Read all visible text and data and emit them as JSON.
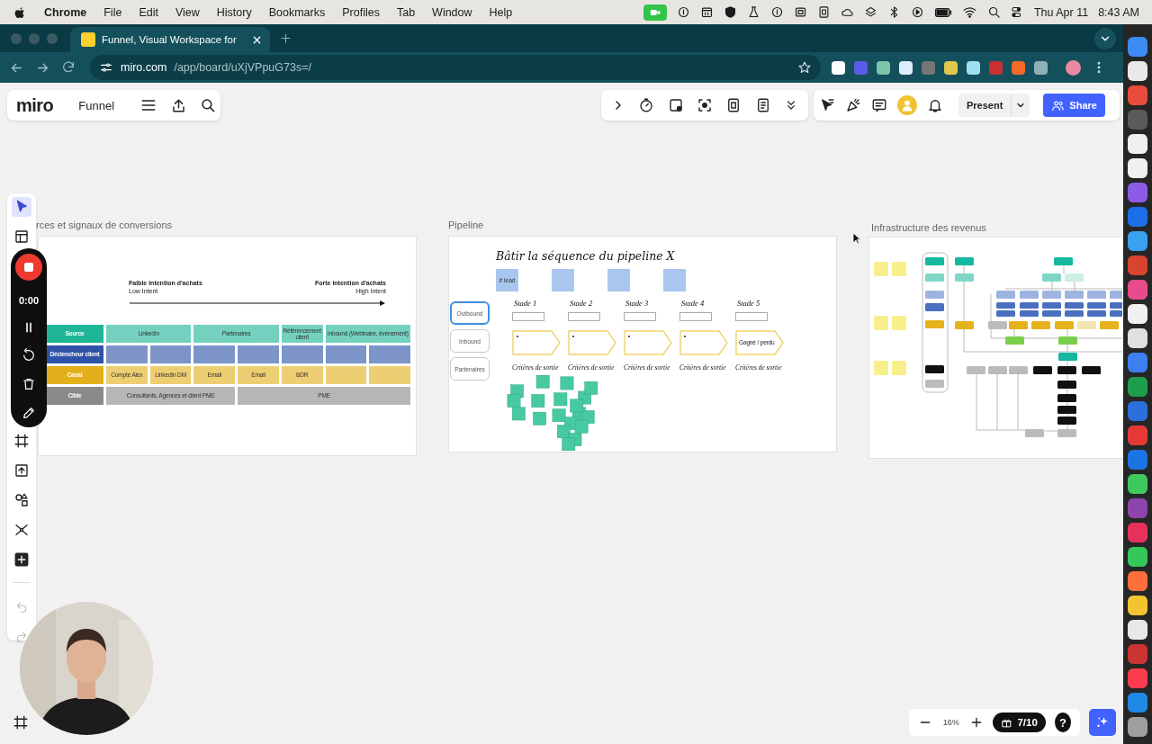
{
  "menubar": {
    "app_name": "Chrome",
    "menus": [
      "File",
      "Edit",
      "View",
      "History",
      "Bookmarks",
      "Profiles",
      "Tab",
      "Window",
      "Help"
    ],
    "date": "Thu Apr 11",
    "time": "8:43 AM"
  },
  "browser": {
    "tab": {
      "title": "Funnel, Visual Workspace for",
      "selected": true
    },
    "url": {
      "host": "miro.com",
      "path": "/app/board/uXjVPpuG73s=/"
    }
  },
  "board_header": {
    "logo": "miro",
    "board_name": "Funnel"
  },
  "top_toolbar": {
    "present": "Present",
    "share": "Share"
  },
  "left_toolbar": {
    "tools": [
      {
        "kind": "select",
        "selected": true
      },
      {
        "kind": "templates",
        "selected": false
      },
      {
        "kind": "frame",
        "selected": false
      },
      {
        "kind": "upload",
        "selected": false
      },
      {
        "kind": "shapes",
        "selected": false
      },
      {
        "kind": "mindmap",
        "selected": false
      },
      {
        "kind": "more",
        "selected": false
      }
    ],
    "history": [
      {
        "kind": "undo",
        "disabled": true
      },
      {
        "kind": "redo",
        "disabled": true
      }
    ]
  },
  "recorder": {
    "time": "0:00"
  },
  "frames": [
    {
      "kind": "matrix",
      "title": "rces et signaux de conversions",
      "low_intent": {
        "label": "Faible intention d'achats",
        "sublabel": "Low Intent"
      },
      "high_intent": {
        "label": "Forte intention d'achats",
        "sublabel": "High Intent"
      },
      "rows": [
        {
          "header": "Source",
          "color": "#1fb597",
          "blocks": [
            {
              "kind": "label",
              "text": "LinkedIn"
            },
            {
              "kind": "label",
              "text": "Partenaires"
            },
            {
              "kind": "label",
              "text": "Référencement client"
            },
            {
              "kind": "label",
              "text": "Inbound (Webinaire, événement)"
            }
          ]
        },
        {
          "header": "Déclencheur client",
          "color": "#2e52a8",
          "blocks": [
            {
              "kind": "blank"
            },
            {
              "kind": "blank"
            },
            {
              "kind": "blank"
            },
            {
              "kind": "blank"
            },
            {
              "kind": "blank"
            },
            {
              "kind": "blank"
            },
            {
              "kind": "blank"
            }
          ]
        },
        {
          "header": "Canal",
          "color": "#e3b01c",
          "blocks": [
            {
              "kind": "label",
              "text": "Compte Alex"
            },
            {
              "kind": "label",
              "text": "LinkedIn DM"
            },
            {
              "kind": "label",
              "text": "Email"
            },
            {
              "kind": "label",
              "text": "Email"
            },
            {
              "kind": "label",
              "text": "BDR"
            },
            {
              "kind": "blank"
            },
            {
              "kind": "blank"
            }
          ]
        },
        {
          "header": "Cible",
          "color": "#8a8a8a",
          "blocks": [
            {
              "kind": "label",
              "text": "Consultants, Agences et client PME"
            },
            {
              "kind": "label",
              "text": "PME"
            }
          ]
        }
      ]
    },
    {
      "kind": "pipeline",
      "title": "Pipeline",
      "heading": "Bâtir la séquence du pipeline X",
      "channels": [
        {
          "label": "Outbound",
          "selected": true
        },
        {
          "label": "Inbound",
          "selected": false
        },
        {
          "label": "Partenaires",
          "selected": false
        }
      ],
      "stages": [
        {
          "label": "Stade 1",
          "note": {
            "kind": "label",
            "text": "# lead"
          },
          "exit": "Critères de sortie"
        },
        {
          "label": "Stade 2",
          "note": {
            "kind": "blank"
          },
          "exit": "Critères de sortie"
        },
        {
          "label": "Stade 3",
          "note": {
            "kind": "blank"
          },
          "exit": "Critères de sortie"
        },
        {
          "label": "Stade 4",
          "note": {
            "kind": "blank"
          },
          "exit": "Critères de sortie"
        },
        {
          "label": "Stade 5",
          "outcome": "Gagné / perdu",
          "exit": "Critères de sortie"
        }
      ]
    },
    {
      "kind": "flowchart",
      "title": "Infrastructure des revenus"
    }
  ],
  "zoom_controls": {
    "zoom": "16%",
    "credits": "7/10",
    "help": "?"
  }
}
